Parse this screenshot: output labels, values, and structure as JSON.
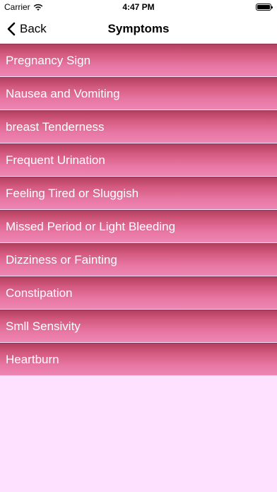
{
  "status_bar": {
    "carrier": "Carrier",
    "wifi_icon": "wifi-icon",
    "time": "4:47 PM",
    "battery_icon": "battery-icon"
  },
  "nav": {
    "back_label": "Back",
    "back_icon": "chevron-left-icon",
    "title": "Symptoms"
  },
  "symptoms": [
    "Pregnancy Sign",
    "Nausea and Vomiting",
    "breast Tenderness",
    "Frequent Urination",
    "Feeling Tired or Sluggish",
    "Missed Period or Light Bleeding",
    "Dizziness or Fainting",
    "Constipation",
    "Smll Sensivity",
    "Heartburn"
  ],
  "colors": {
    "background": "#fee1fe",
    "row_top": "#b3405f",
    "row_bottom": "#ee86b2"
  }
}
